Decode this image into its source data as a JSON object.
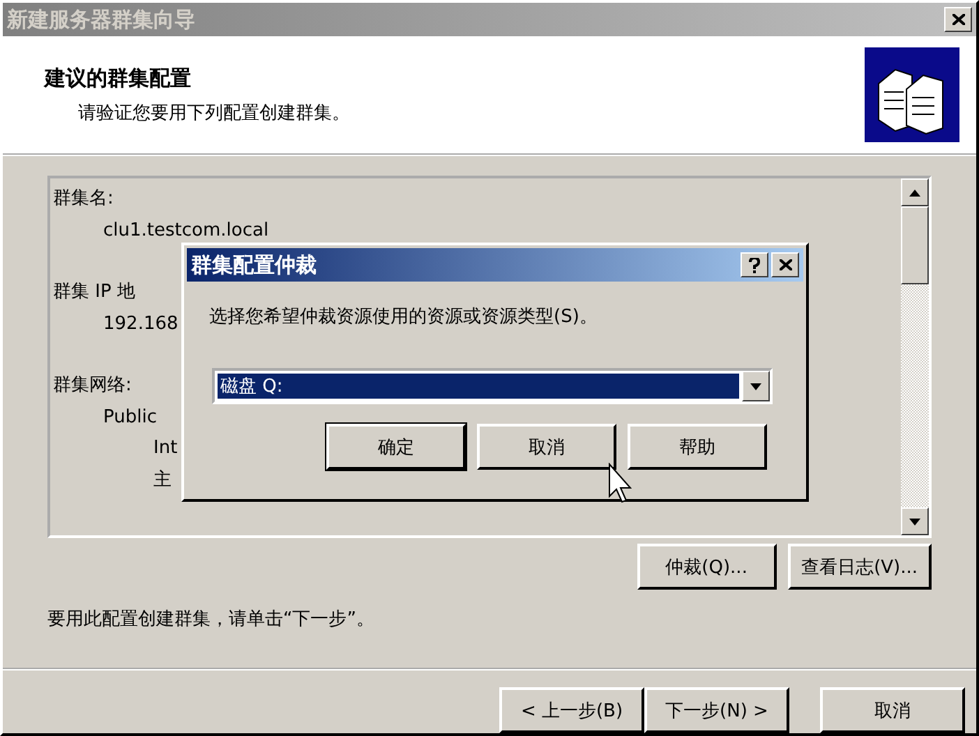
{
  "window": {
    "title": "新建服务器群集向导",
    "active": false
  },
  "header": {
    "title": "建议的群集配置",
    "subtitle": "请验证您要用下列配置创建群集。"
  },
  "config_listing": [
    {
      "text": "群集名:",
      "children": [
        {
          "text": "clu1.testcom.local"
        }
      ]
    },
    {
      "text": "群集 IP 地",
      "children": [
        {
          "text": "192.168"
        }
      ]
    },
    {
      "text": "群集网络:",
      "children": [
        {
          "text": "Public",
          "children": [
            {
              "text": "Int"
            },
            {
              "text": "主"
            }
          ]
        }
      ]
    }
  ],
  "listing_buttons": [
    "仲裁(Q)...",
    "查看日志(V)..."
  ],
  "instruction": "要用此配置创建群集，请单击“下一步”。",
  "nav_buttons": [
    {
      "label": "< 上一步(B)",
      "default": false
    },
    {
      "label": "下一步(N) >",
      "default": false
    },
    {
      "label": "取消",
      "default": false
    }
  ],
  "dialog": {
    "title": "群集配置仲裁",
    "active": true,
    "prompt": "选择您希望仲裁资源使用的资源或资源类型(S)。",
    "combo": {
      "value": "磁盘 Q:",
      "focused": true
    },
    "buttons": [
      {
        "label": "确定",
        "default": true
      },
      {
        "label": "取消",
        "default": false
      },
      {
        "label": "帮助",
        "default": false
      }
    ]
  }
}
